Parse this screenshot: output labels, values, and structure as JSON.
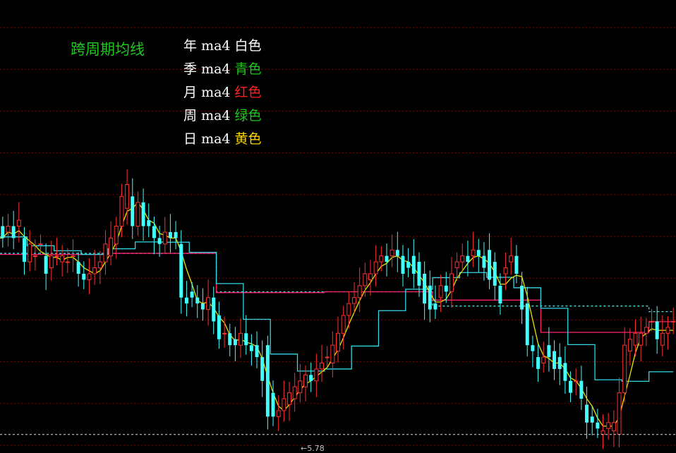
{
  "title": "跨周期均线",
  "colors": {
    "background": "#000000",
    "grid": "#8b0000",
    "title": "#1ec81e",
    "up": "#ff3030",
    "down": "#40ffff",
    "year_ma": "#ffffff",
    "quarter_ma": "#40e0e0",
    "month_ma": "#ff1f6b",
    "week_ma": "#30d8e8",
    "day_ma": "#e6e600"
  },
  "legend": [
    {
      "period": "年",
      "ma": "ma4",
      "color_name": "白色",
      "color": "#ffffff"
    },
    {
      "period": "季",
      "ma": "ma4",
      "color_name": "青色",
      "color": "#1ec81e"
    },
    {
      "period": "月",
      "ma": "ma4",
      "color_name": "红色",
      "color": "#ff2020"
    },
    {
      "period": "周",
      "ma": "ma4",
      "color_name": "绿色",
      "color": "#1ec81e"
    },
    {
      "period": "日",
      "ma": "ma4",
      "color_name": "黄色",
      "color": "#ffd700"
    }
  ],
  "low_label": "←5.78",
  "chart_data": {
    "type": "candlestick",
    "title": "跨周期均线",
    "ylim": [
      5.7,
      9.5
    ],
    "reference_price": 5.85,
    "low_price": 5.78,
    "x": [
      1,
      2,
      3,
      4,
      5,
      6,
      7,
      8,
      9,
      10,
      11,
      12,
      13,
      14,
      15,
      16,
      17,
      18,
      19,
      20,
      21,
      22,
      23,
      24,
      25,
      26,
      27,
      28,
      29,
      30,
      31,
      32,
      33,
      34,
      35,
      36,
      37,
      38,
      39,
      40,
      41,
      42,
      43,
      44,
      45,
      46,
      47,
      48,
      49,
      50,
      51,
      52,
      53,
      54,
      55,
      56,
      57,
      58,
      59,
      60,
      61,
      62,
      63,
      64,
      65,
      66,
      67,
      68,
      69,
      70,
      71,
      72,
      73,
      74,
      75,
      76,
      77,
      78,
      79,
      80,
      81,
      82,
      83,
      84,
      85,
      86,
      87,
      88,
      89,
      90,
      91,
      92,
      93,
      94,
      95,
      96,
      97,
      98,
      99,
      100,
      101,
      102,
      103,
      104,
      105,
      106,
      107,
      108,
      109,
      110,
      111,
      112,
      113,
      114,
      115,
      116,
      117,
      118,
      119,
      120,
      121,
      122,
      123,
      124,
      125,
      126,
      127,
      128,
      129,
      130,
      131,
      132,
      133,
      134,
      135,
      136,
      137,
      138,
      139,
      140,
      141,
      142,
      143,
      144,
      145,
      146,
      147,
      148,
      149,
      150,
      151,
      152,
      153,
      154,
      155,
      156,
      157,
      158,
      159,
      160
    ],
    "open": [
      7.6,
      7.55,
      7.6,
      7.6,
      7.5,
      7.3,
      7.35,
      7.45,
      7.35,
      7.25,
      7.35,
      7.3,
      7.3,
      7.35,
      7.3,
      7.2,
      7.15,
      7.2,
      7.25,
      7.3,
      7.35,
      7.45,
      7.6,
      7.75,
      7.85,
      7.6,
      7.8,
      7.65,
      7.6,
      7.5,
      7.45,
      7.55,
      7.55,
      7.45,
      7.0,
      7.05,
      7.0,
      6.95,
      6.9,
      7.0,
      6.85,
      6.7,
      6.7,
      6.65,
      6.6,
      6.7,
      6.6,
      6.6,
      6.5,
      6.6,
      6.2,
      6.0,
      6.05,
      6.1,
      6.15,
      6.2,
      6.25,
      6.35,
      6.3,
      6.4,
      6.5,
      6.45,
      6.55,
      6.7,
      6.85,
      6.95,
      7.0,
      7.1,
      7.15,
      7.2,
      7.3,
      7.35,
      7.35,
      7.4,
      7.35,
      7.3,
      7.35,
      7.3,
      7.2,
      7.1,
      6.95,
      7.0,
      7.1,
      7.05,
      7.25,
      7.3,
      7.35,
      7.35,
      7.4,
      7.35,
      7.4,
      7.3,
      7.1,
      7.2,
      7.3,
      7.35,
      7.1,
      6.95,
      6.6,
      6.5,
      6.45,
      6.6,
      6.55,
      6.5,
      6.45,
      6.3,
      6.3,
      6.3,
      6.1,
      6.0,
      5.95,
      5.85,
      5.9,
      5.88,
      5.85,
      6.2,
      6.55,
      6.6,
      6.6,
      6.7,
      6.8,
      6.8,
      6.6,
      6.7,
      6.8
    ],
    "close": [
      7.5,
      7.6,
      7.5,
      7.65,
      7.3,
      7.45,
      7.35,
      7.45,
      7.2,
      7.35,
      7.35,
      7.35,
      7.3,
      7.35,
      7.2,
      7.15,
      7.2,
      7.25,
      7.3,
      7.45,
      7.5,
      7.6,
      7.85,
      7.95,
      7.6,
      7.8,
      7.6,
      7.6,
      7.5,
      7.45,
      7.55,
      7.5,
      7.5,
      7.0,
      6.95,
      7.0,
      6.95,
      6.9,
      7.0,
      6.8,
      6.65,
      6.7,
      6.6,
      6.6,
      6.7,
      6.6,
      6.55,
      6.5,
      6.3,
      6.0,
      6.0,
      6.05,
      6.15,
      6.2,
      6.25,
      6.3,
      6.35,
      6.3,
      6.4,
      6.45,
      6.5,
      6.6,
      6.7,
      6.85,
      6.95,
      7.0,
      7.1,
      7.2,
      7.2,
      7.3,
      7.35,
      7.3,
      7.4,
      7.35,
      7.2,
      7.25,
      7.2,
      7.1,
      6.95,
      6.9,
      6.9,
      7.1,
      7.05,
      7.2,
      7.3,
      7.35,
      7.3,
      7.4,
      7.35,
      7.25,
      7.15,
      7.1,
      6.95,
      7.25,
      7.35,
      7.2,
      6.9,
      6.6,
      6.55,
      6.4,
      6.5,
      6.5,
      6.4,
      6.4,
      6.3,
      6.2,
      6.3,
      6.15,
      5.95,
      5.95,
      5.9,
      5.88,
      5.95,
      5.95,
      6.2,
      6.6,
      6.65,
      6.7,
      6.7,
      6.75,
      6.8,
      6.65,
      6.7,
      6.75,
      6.8
    ]
  }
}
